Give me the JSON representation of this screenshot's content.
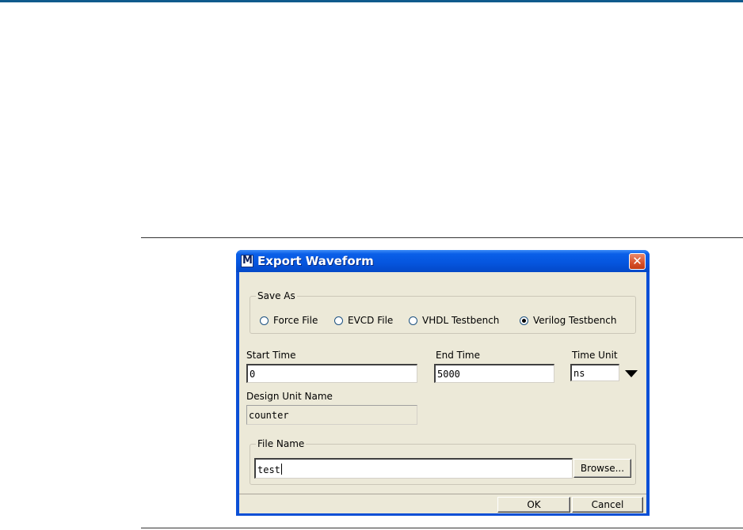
{
  "dialog": {
    "title": "Export Waveform",
    "app_icon_letter": "M",
    "close_symbol": "✕"
  },
  "save_as": {
    "group_label": "Save As",
    "options": [
      {
        "label": "Force File",
        "selected": false
      },
      {
        "label": "EVCD File",
        "selected": false
      },
      {
        "label": "VHDL Testbench",
        "selected": false
      },
      {
        "label": "Verilog Testbench",
        "selected": true
      }
    ]
  },
  "start_time": {
    "label": "Start Time",
    "value": "0"
  },
  "end_time": {
    "label": "End Time",
    "value": "5000"
  },
  "time_unit": {
    "label": "Time Unit",
    "value": "ns"
  },
  "design_unit": {
    "label": "Design Unit Name",
    "value": "counter"
  },
  "file_name": {
    "group_label": "File Name",
    "value": "test",
    "browse_label": "Browse..."
  },
  "buttons": {
    "ok_label": "OK",
    "cancel_label": "Cancel"
  },
  "icons": {
    "app": "modelsim-icon",
    "close": "close-icon",
    "dropdown": "dropdown-arrow-icon"
  }
}
